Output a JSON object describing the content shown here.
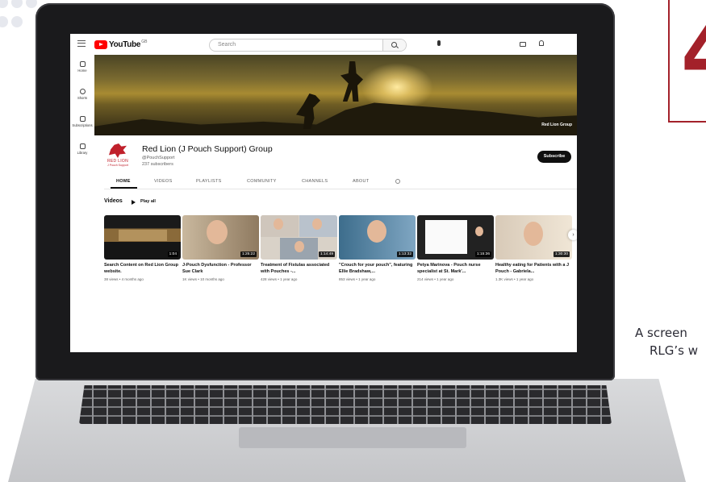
{
  "badge": {
    "number": "4",
    "color": "#a3212a"
  },
  "caption": {
    "line1": "A screen",
    "line2": "RLG’s w"
  },
  "youtube": {
    "logo_text": "YouTube",
    "logo_region": "GB",
    "search_placeholder": "Search",
    "sidebar": [
      {
        "label": "Home",
        "icon": "home-icon"
      },
      {
        "label": "Shorts",
        "icon": "shorts-icon"
      },
      {
        "label": "Subscriptions",
        "icon": "subscriptions-icon"
      },
      {
        "label": "Library",
        "icon": "library-icon"
      }
    ],
    "banner_tag": "Red Lion Group",
    "channel": {
      "logo_text": "RED LION",
      "logo_sub": "J Pouch Support",
      "name": "Red Lion (J Pouch Support) Group",
      "handle": "@PouchSupport",
      "subscribers": "237 subscribers",
      "subscribe_label": "Subscribe"
    },
    "tabs": [
      "HOME",
      "VIDEOS",
      "PLAYLISTS",
      "COMMUNITY",
      "CHANNELS",
      "ABOUT"
    ],
    "active_tab": "HOME",
    "section": {
      "title": "Videos",
      "play_all": "Play all"
    },
    "videos": [
      {
        "title": "Search Content on Red Lion Group website.",
        "meta": "38 views • 4 months ago",
        "duration": "1:04"
      },
      {
        "title": "J-Pouch Dysfunction - Professor Sue Clark",
        "meta": "1K views • 10 months ago",
        "duration": "1:25:22"
      },
      {
        "title": "Treatment of Fistulas associated with Pouches -...",
        "meta": "428 views • 1 year ago",
        "duration": "1:14:49"
      },
      {
        "title": "\"Crouch for your pouch\", featuring Ellie Bradshaw,...",
        "meta": "853 views • 1 year ago",
        "duration": "1:13:32"
      },
      {
        "title": "Petya Marinova - Pouch nurse specialist at St. Mark'...",
        "meta": "214 views • 1 year ago",
        "duration": "1:15:36"
      },
      {
        "title": "Healthy eating for Patients with a J Pouch - Gabriela...",
        "meta": "1.3K views • 1 year ago",
        "duration": "1:30:30"
      }
    ],
    "next_arrow": "›"
  }
}
